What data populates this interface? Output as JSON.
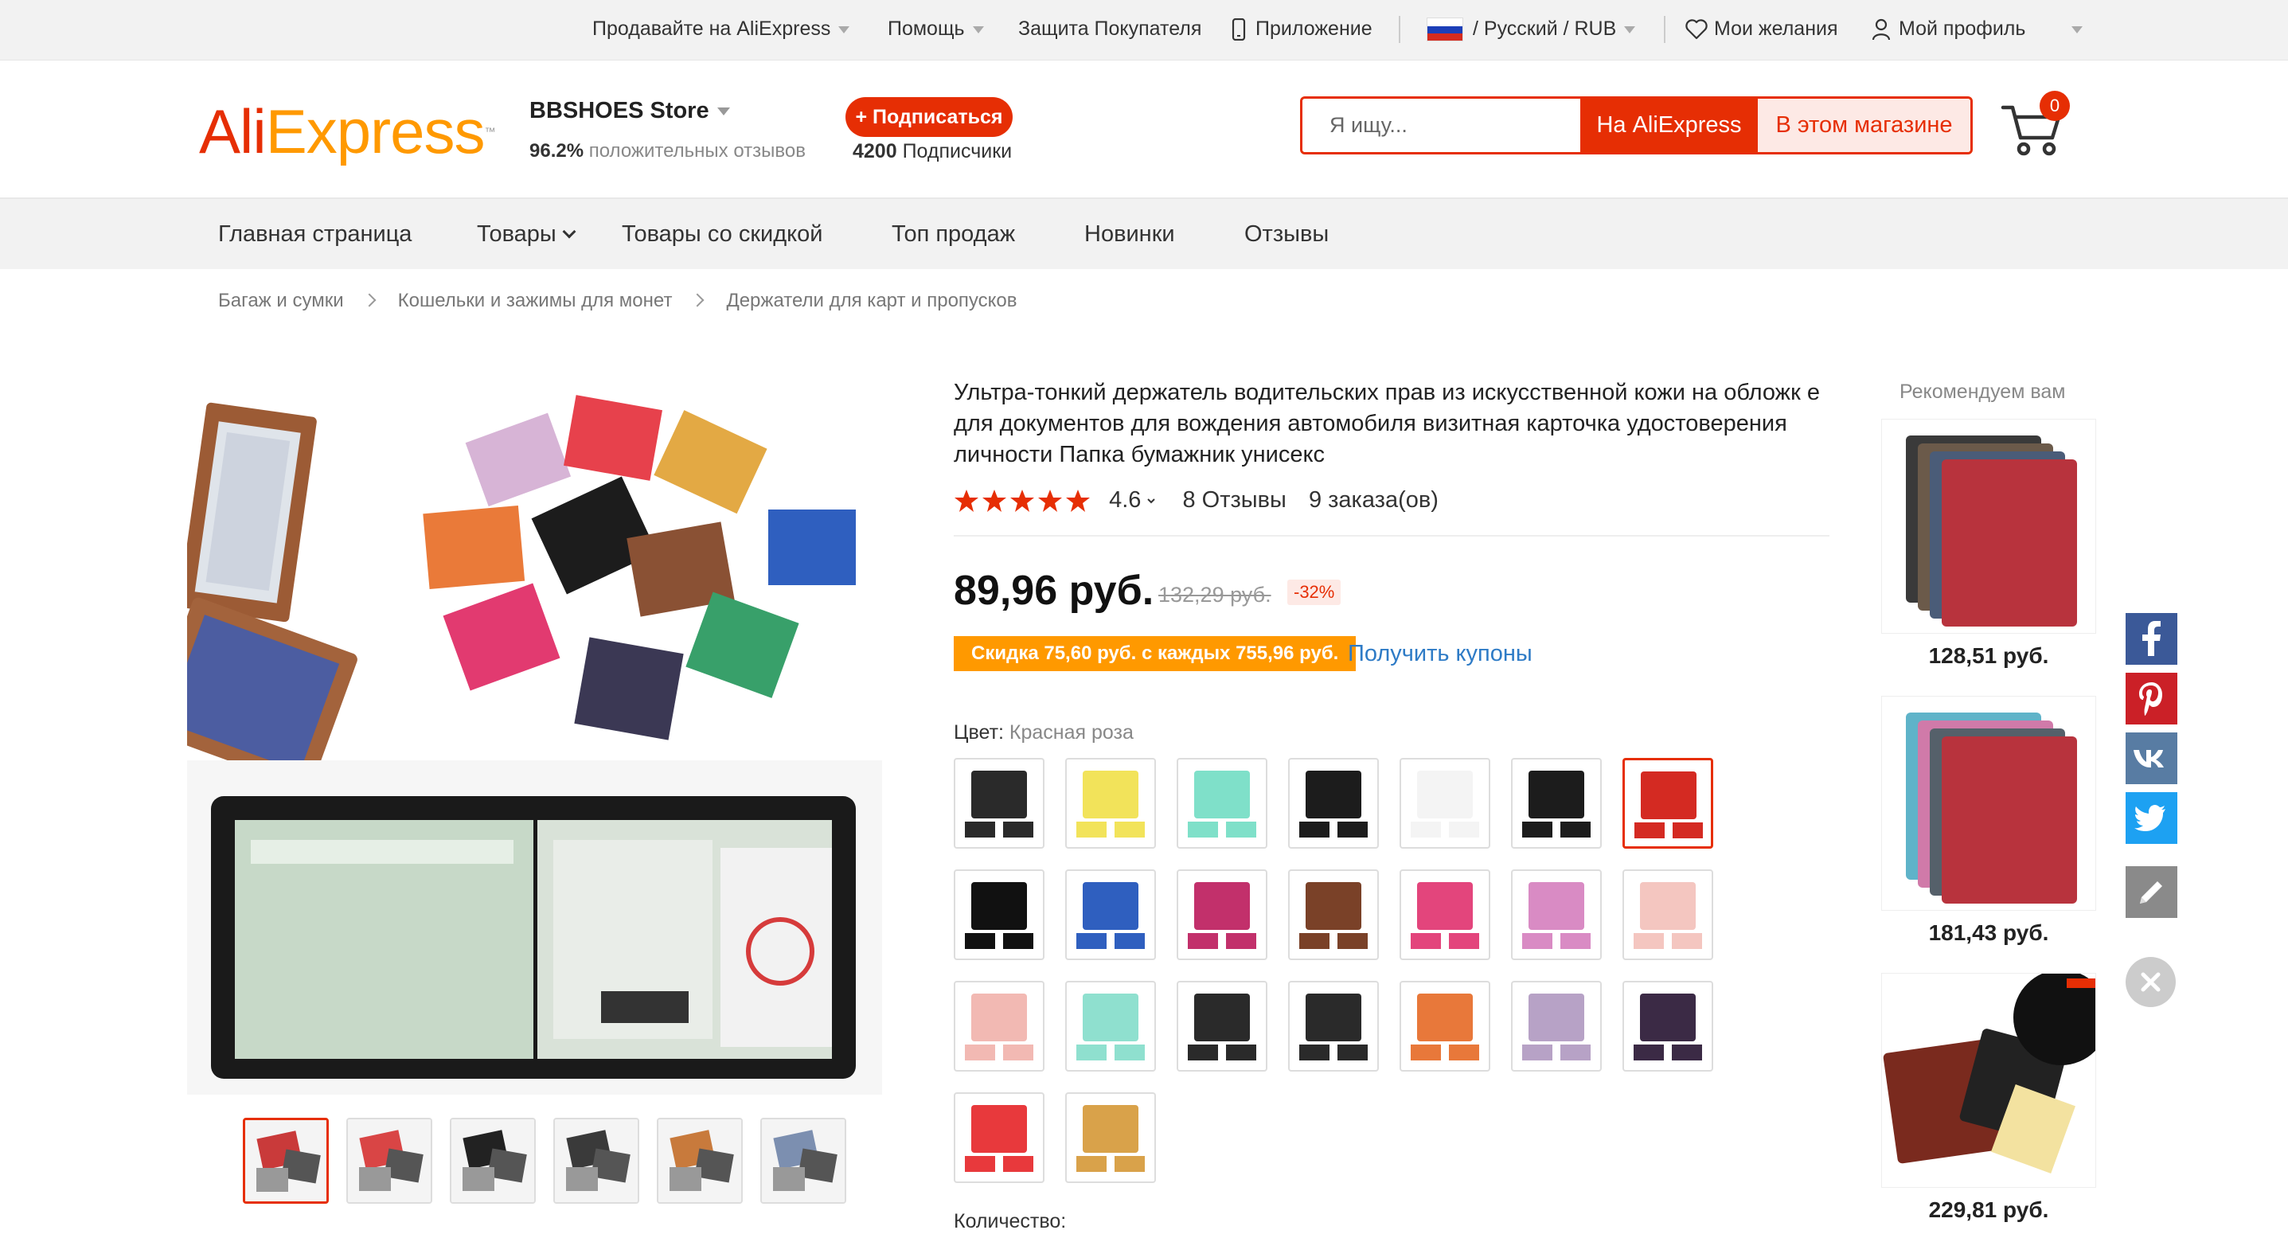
{
  "topbar": {
    "sell": "Продавайте на AliExpress",
    "help": "Помощь",
    "protection": "Защита Покупателя",
    "app": "Приложение",
    "locale": "/ Русский /  RUB",
    "wishlist": "Мои желания",
    "profile": "Мой профиль"
  },
  "header": {
    "logo_part1": "Ali",
    "logo_part2": "Express",
    "store_name": "BBSHOES Store",
    "rating_value": "96.2%",
    "rating_text": "положительных отзывов",
    "subscribe_label": "+ Подписаться",
    "subscribers_count": "4200",
    "subscribers_text": "Подписчики",
    "search_placeholder": "Я ищу...",
    "search_btn_aliexpress": "На AliExpress",
    "search_btn_store": "В этом магазине",
    "cart_count": "0"
  },
  "nav": {
    "items": [
      "Главная страница",
      "Товары",
      "Товары со скидкой",
      "Топ продаж",
      "Новинки",
      "Отзывы"
    ]
  },
  "breadcrumb": [
    "Багаж и сумки",
    "Кошельки и зажимы для монет",
    "Держатели для карт и пропусков"
  ],
  "product": {
    "title": "Ультра-тонкий держатель водительских прав из искусственной кожи на обложк е для документов для вождения автомобиля визитная карточка удостоверения личности Папка бумажник унисекс",
    "rating": "4.6",
    "reviews": "8 Отзывы",
    "orders": "9 заказа(ов)",
    "price": "89,96 руб.",
    "old_price": "132,29 руб.",
    "discount": "-32%",
    "coupon": "Скидка 75,60 руб. с каждых 755,96 руб.",
    "coupon_link": "Получить купоны",
    "color_label": "Цвет:",
    "color_value": "Красная роза",
    "quantity_label": "Количество:",
    "stars": 5,
    "colors": [
      "#2a2a2a",
      "#f2e35a",
      "#7fe0c9",
      "#1c1c1c",
      "#f4f4f4",
      "#1c1c1c",
      "#d42a22",
      "#111111",
      "#2f5fbf",
      "#c2306b",
      "#7a4128",
      "#e3457c",
      "#d98bc4",
      "#f4c6c0",
      "#f2b9b3",
      "#8fe0cf",
      "#2a2a2a",
      "#2a2a2a",
      "#e8783a",
      "#b7a2c6",
      "#3b2a45",
      "#e8393c",
      "#d9a24a"
    ],
    "thumb_colors": [
      "#c93a3a",
      "#d94545",
      "#222222",
      "#3a3a3a",
      "#c87a3c",
      "#7c8fb0"
    ]
  },
  "recommend": {
    "title": "Рекомендуем вам",
    "items": [
      {
        "price": "128,51 руб.",
        "color": "#b8333d"
      },
      {
        "price": "181,43 руб.",
        "color": "#b8333d"
      },
      {
        "price": "229,81 руб.",
        "color": "#7a2a1e"
      }
    ]
  },
  "social": [
    "facebook",
    "pinterest",
    "vk",
    "twitter",
    "edit"
  ],
  "colors": {
    "accent": "#e62e04",
    "coupon": "#ff9900",
    "link": "#2e7bc6"
  }
}
